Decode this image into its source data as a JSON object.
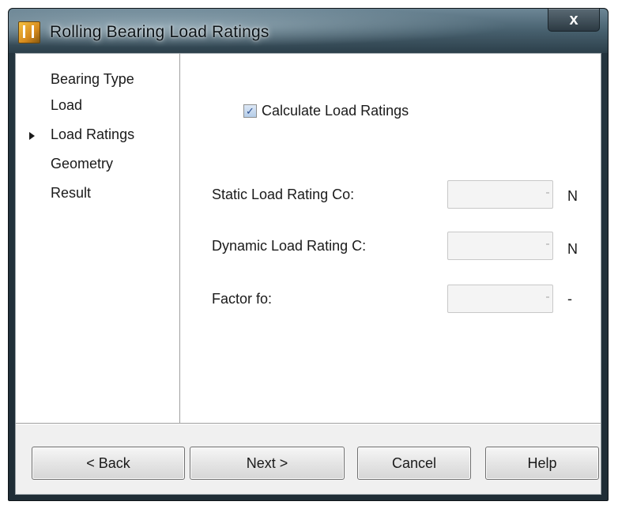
{
  "window": {
    "title": "Rolling Bearing Load Ratings",
    "close_label": "x"
  },
  "nav": {
    "items": [
      {
        "label": "Bearing Type",
        "active": false
      },
      {
        "label": "Load",
        "active": false
      },
      {
        "label": "Load Ratings",
        "active": true
      },
      {
        "label": "Geometry",
        "active": false
      },
      {
        "label": "Result",
        "active": false
      }
    ]
  },
  "form": {
    "checkbox_label": "Calculate Load Ratings",
    "checkbox_checked": true,
    "fields": [
      {
        "label": "Static Load Rating Co:",
        "value": "",
        "unit": "N"
      },
      {
        "label": "Dynamic Load Rating C:",
        "value": "",
        "unit": "N"
      },
      {
        "label": "Factor fo:",
        "value": "",
        "unit": "-"
      }
    ]
  },
  "buttons": {
    "back": "< Back",
    "next": "Next >",
    "cancel": "Cancel",
    "help": "Help"
  },
  "icons": {
    "app": "app-icon",
    "close": "close-icon",
    "active_nav": "triangle-right-icon"
  }
}
